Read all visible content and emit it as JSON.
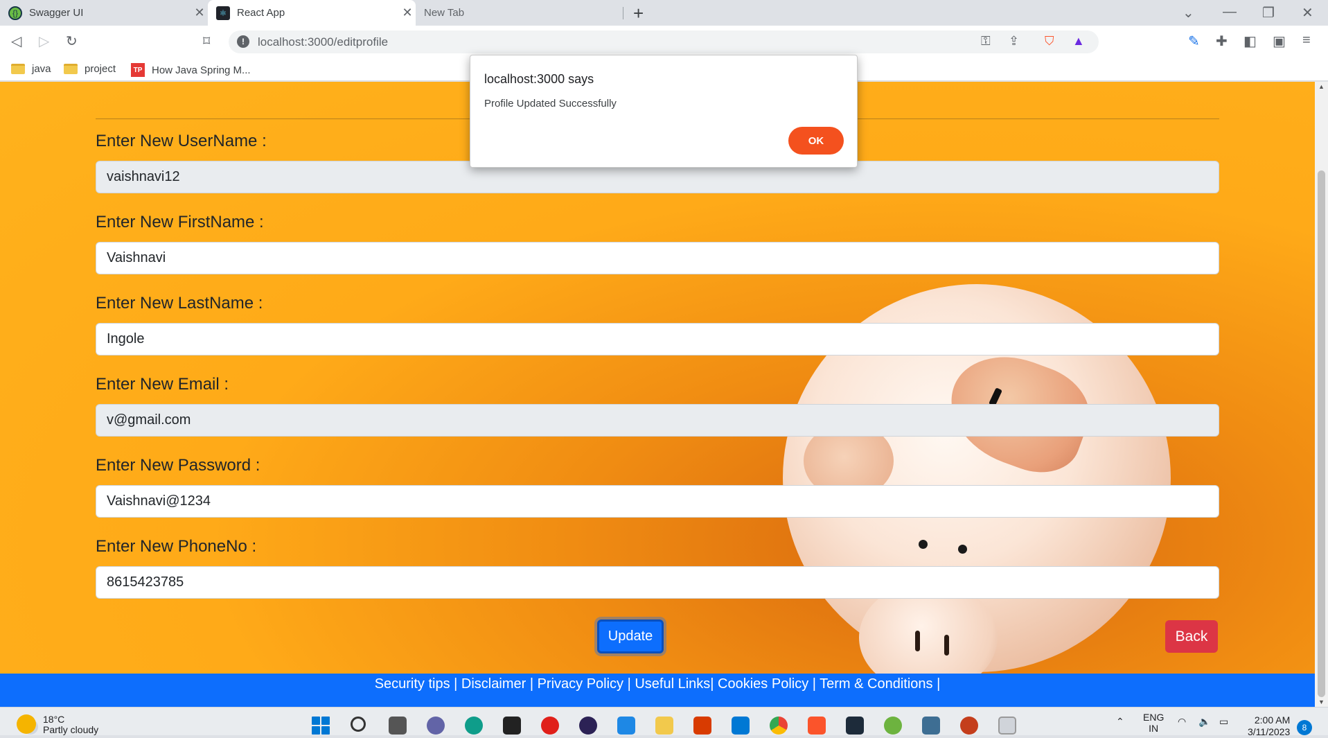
{
  "browser": {
    "tabs": [
      {
        "title": "Swagger UI",
        "close": "✕"
      },
      {
        "title": "React App",
        "close": "✕"
      },
      {
        "title": "New Tab"
      }
    ],
    "new_tab": "+",
    "url": "localhost:3000/editprofile",
    "bookmarks": [
      {
        "label": "java",
        "icon": "folder-icon"
      },
      {
        "label": "project",
        "icon": "folder-icon"
      },
      {
        "label": "How Java Spring M...",
        "icon": "tp-icon",
        "icon_text": "TP"
      }
    ]
  },
  "form": {
    "fields": [
      {
        "label": "Enter New UserName :",
        "value": "vaishnavi12",
        "readonly": true
      },
      {
        "label": "Enter New FirstName :",
        "value": "Vaishnavi",
        "readonly": false
      },
      {
        "label": "Enter New LastName :",
        "value": "Ingole",
        "readonly": false
      },
      {
        "label": "Enter New Email :",
        "value": "v@gmail.com",
        "readonly": true
      },
      {
        "label": "Enter New Password :",
        "value": "Vaishnavi@1234",
        "readonly": false
      },
      {
        "label": "Enter New PhoneNo :",
        "value": "8615423785",
        "readonly": false
      }
    ],
    "update_label": "Update",
    "back_label": "Back"
  },
  "footer": {
    "text": "Security tips | Disclaimer | Privacy Policy | Useful Links| Cookies Policy | Term & Conditions |"
  },
  "dialog": {
    "title": "localhost:3000 says",
    "message": "Profile Updated Successfully",
    "ok_label": "OK"
  },
  "taskbar": {
    "temperature": "18°C",
    "condition": "Partly cloudy",
    "language": "ENG",
    "region": "IN",
    "time": "2:00 AM",
    "date": "3/11/2023",
    "notifications": "8"
  },
  "colors": {
    "primary": "#0d6efd",
    "danger": "#dc3545",
    "dialog_accent": "#f4511e",
    "page_background": "#ffb21c"
  }
}
